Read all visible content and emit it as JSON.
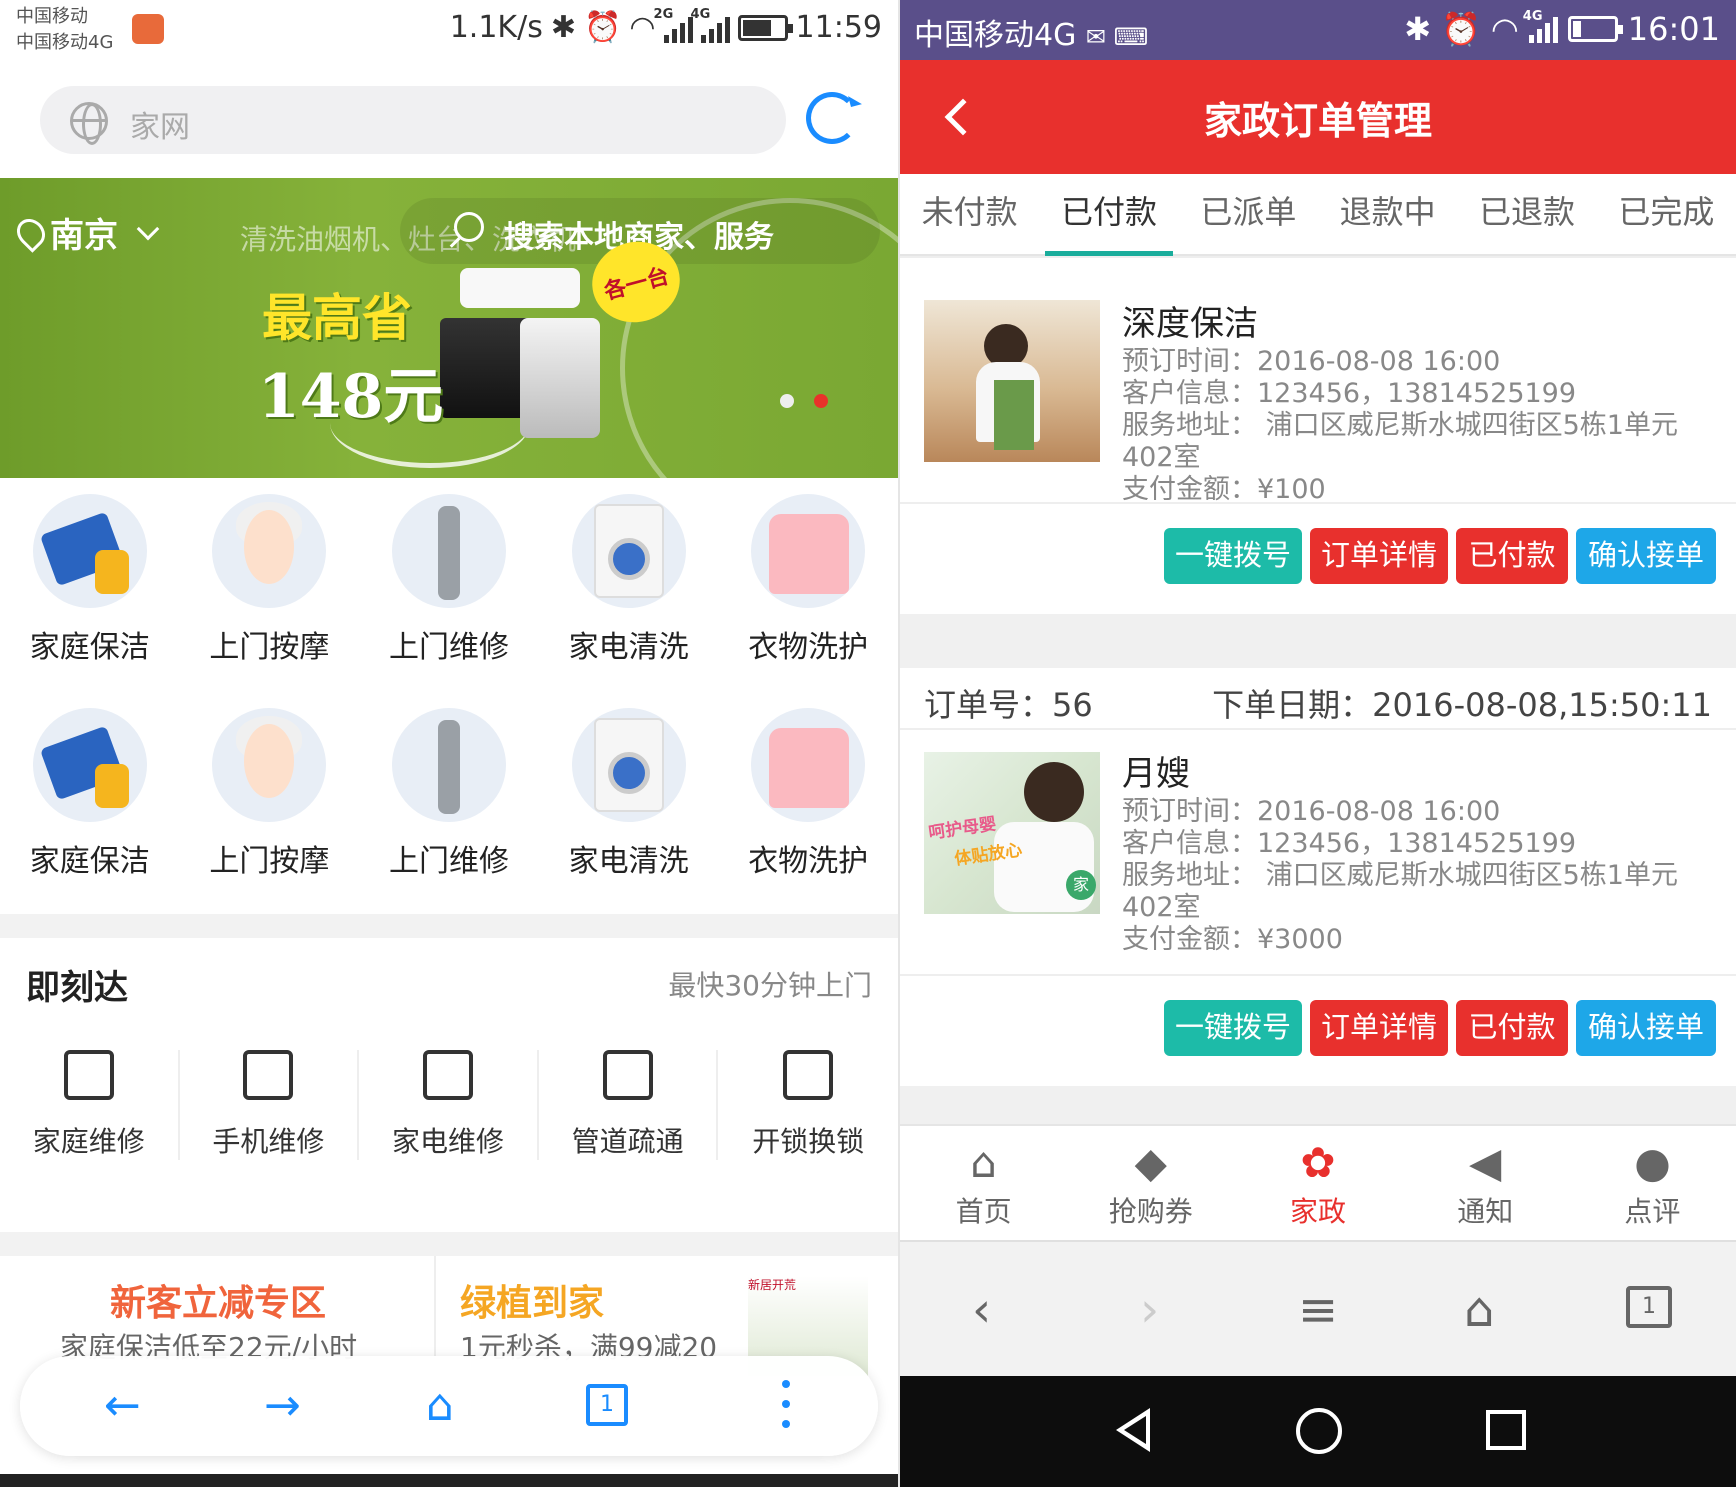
{
  "left": {
    "status": {
      "carrier1": "中国移动",
      "carrier2": "中国移动4G",
      "speed": "1.1K/s",
      "sig1": "2G",
      "sig2": "4G",
      "time": "11:59"
    },
    "search_placeholder": "家网",
    "banner": {
      "city": "南京",
      "faded_text": "清洗油烟机、灶台、洗衣机",
      "search_text": "搜索本地商家、服务",
      "promo_line1": "最高省",
      "promo_line2": "148元",
      "badge": "各一台"
    },
    "categories": [
      {
        "label": "家庭保洁",
        "icon": "cleaning-cloth-icon"
      },
      {
        "label": "上门按摩",
        "icon": "massage-face-icon"
      },
      {
        "label": "上门维修",
        "icon": "wrench-icon"
      },
      {
        "label": "家电清洗",
        "icon": "washing-machine-icon"
      },
      {
        "label": "衣物洗护",
        "icon": "shirt-icon"
      },
      {
        "label": "家庭保洁",
        "icon": "cleaning-cloth-icon"
      },
      {
        "label": "上门按摩",
        "icon": "massage-face-icon"
      },
      {
        "label": "上门维修",
        "icon": "wrench-icon"
      },
      {
        "label": "家电清洗",
        "icon": "washing-machine-icon"
      },
      {
        "label": "衣物洗护",
        "icon": "shirt-icon"
      }
    ],
    "quick": {
      "title": "即刻达",
      "subtitle": "最快30分钟上门",
      "items": [
        {
          "label": "家庭维修",
          "icon": "house-repair-icon"
        },
        {
          "label": "手机维修",
          "icon": "phone-icon"
        },
        {
          "label": "家电维修",
          "icon": "fridge-repair-icon"
        },
        {
          "label": "管道疏通",
          "icon": "pipe-icon"
        },
        {
          "label": "开锁换锁",
          "icon": "lock-icon"
        }
      ]
    },
    "promos": [
      {
        "title": "新客立减专区",
        "desc": "家庭保洁低至22元/小时",
        "color": "#f0643c"
      },
      {
        "title": "绿植到家",
        "desc": "1元秒杀，满99减20",
        "color": "#f5a623",
        "img_text": "新居开荒"
      }
    ],
    "browser_tab_count": "1"
  },
  "right": {
    "status": {
      "carrier": "中国移动4G",
      "sig": "4G",
      "time": "16:01"
    },
    "title": "家政订单管理",
    "tabs": [
      "未付款",
      "已付款",
      "已派单",
      "退款中",
      "已退款",
      "已完成"
    ],
    "active_tab": 1,
    "orders": [
      {
        "name": "深度保洁",
        "time": "预订时间：2016-08-08 16:00",
        "customer": "客户信息：123456，13814525199",
        "address": "服务地址：  浦口区威尼斯水城四街区5栋1单元402室",
        "amount": "支付金额：¥100"
      },
      {
        "order_no": "订单号：56",
        "order_date": "下单日期：2016-08-08,15:50:11",
        "name": "月嫂",
        "time": "预订时间：2016-08-08 16:00",
        "customer": "客户信息：123456，13814525199",
        "address": "服务地址：  浦口区威尼斯水城四街区5栋1单元402室",
        "amount": "支付金额：¥3000",
        "img_text1": "呵护母婴",
        "img_text2": "体贴放心",
        "img_badge": "家"
      }
    ],
    "buttons": {
      "call": "一键拨号",
      "detail": "订单详情",
      "paid": "已付款",
      "accept": "确认接单"
    },
    "nav": [
      {
        "label": "首页",
        "icon": "home-icon"
      },
      {
        "label": "抢购券",
        "icon": "coupon-tag-icon"
      },
      {
        "label": "家政",
        "icon": "paw-icon"
      },
      {
        "label": "通知",
        "icon": "speaker-icon"
      },
      {
        "label": "点评",
        "icon": "chat-bubble-icon"
      }
    ],
    "active_nav": 2,
    "browser_tab_count": "1",
    "colors": {
      "header": "#e8302d",
      "accent": "#1aad9c",
      "status_bar": "#5a4f8a"
    }
  }
}
